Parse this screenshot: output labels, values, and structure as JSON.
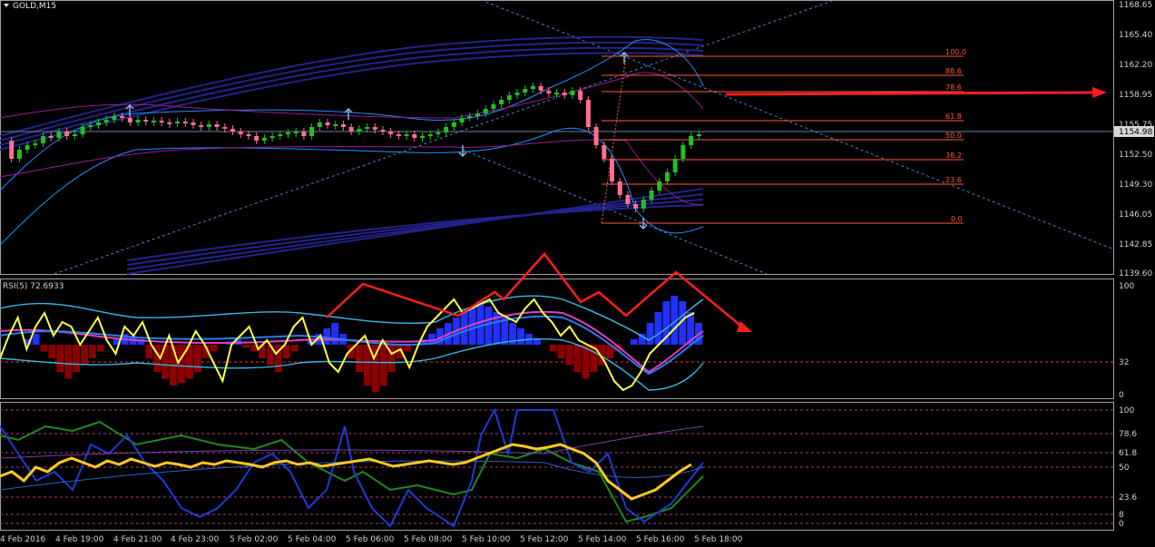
{
  "window": {
    "title": "GOLD,M15",
    "menu_icon": "triangle-down-icon"
  },
  "price_scale": {
    "labels": [
      "1168.65",
      "1165.40",
      "1162.20",
      "1158.95",
      "1155.75",
      "1152.50",
      "1149.30",
      "1146.05",
      "1142.85",
      "1139.60"
    ],
    "current_price": "1154.98"
  },
  "fibonacci": {
    "levels": [
      "100.0",
      "88.6",
      "78.6",
      "61.8",
      "50.0",
      "38.2",
      "23.6",
      "0.0"
    ],
    "color": "#ff5a3c"
  },
  "rsi_panel": {
    "label": "RSI(5) 72.6933",
    "scale": [
      "100",
      "32",
      "0"
    ]
  },
  "stoch_panel": {
    "scale": [
      "100",
      "78.6",
      "61.8",
      "50",
      "23.6",
      "8",
      "0"
    ]
  },
  "time_axis": {
    "labels": [
      "4 Feb 2016",
      "4 Feb 19:00",
      "4 Feb 21:00",
      "4 Feb 23:00",
      "5 Feb 02:00",
      "5 Feb 04:00",
      "5 Feb 06:00",
      "5 Feb 08:00",
      "5 Feb 10:00",
      "5 Feb 12:00",
      "5 Feb 14:00",
      "5 Feb 16:00",
      "5 Feb 18:00"
    ]
  },
  "colors": {
    "bull": "#21c021",
    "bear": "#ff6f8f",
    "annotation": "#ff1e1e",
    "rsi": "#ffff40",
    "bollinger": "#1e90ff",
    "channel": "#2a2aa0"
  }
}
